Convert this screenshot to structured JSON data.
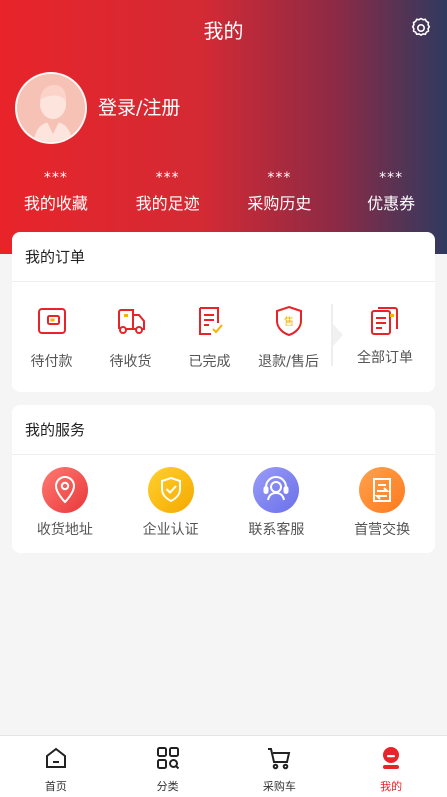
{
  "header": {
    "title": "我的",
    "login_text": "登录/注册"
  },
  "stats": [
    {
      "value": "***",
      "label": "我的收藏"
    },
    {
      "value": "***",
      "label": "我的足迹"
    },
    {
      "value": "***",
      "label": "采购历史"
    },
    {
      "value": "***",
      "label": "优惠券"
    }
  ],
  "orders": {
    "title": "我的订单",
    "items": [
      {
        "label": "待付款",
        "icon": "wallet-icon"
      },
      {
        "label": "待收货",
        "icon": "truck-icon"
      },
      {
        "label": "已完成",
        "icon": "checked-document-icon"
      },
      {
        "label": "退款/售后",
        "icon": "after-sales-shield-icon"
      }
    ],
    "all_label": "全部订单",
    "all_icon": "documents-icon"
  },
  "services": {
    "title": "我的服务",
    "items": [
      {
        "label": "收货地址",
        "icon": "location-pin-icon",
        "color": "#ef5350"
      },
      {
        "label": "企业认证",
        "icon": "shield-check-icon",
        "color": "#f9b900"
      },
      {
        "label": "联系客服",
        "icon": "headset-icon",
        "color": "#7b7ff0"
      },
      {
        "label": "首营交换",
        "icon": "exchange-document-icon",
        "color": "#ff8a2c"
      }
    ]
  },
  "tabbar": [
    {
      "label": "首页",
      "icon": "home-icon"
    },
    {
      "label": "分类",
      "icon": "category-grid-icon"
    },
    {
      "label": "采购车",
      "icon": "cart-icon"
    },
    {
      "label": "我的",
      "icon": "profile-icon",
      "active": true
    }
  ],
  "colors": {
    "accent": "#e8242a",
    "header_end": "#2f3a5f"
  }
}
